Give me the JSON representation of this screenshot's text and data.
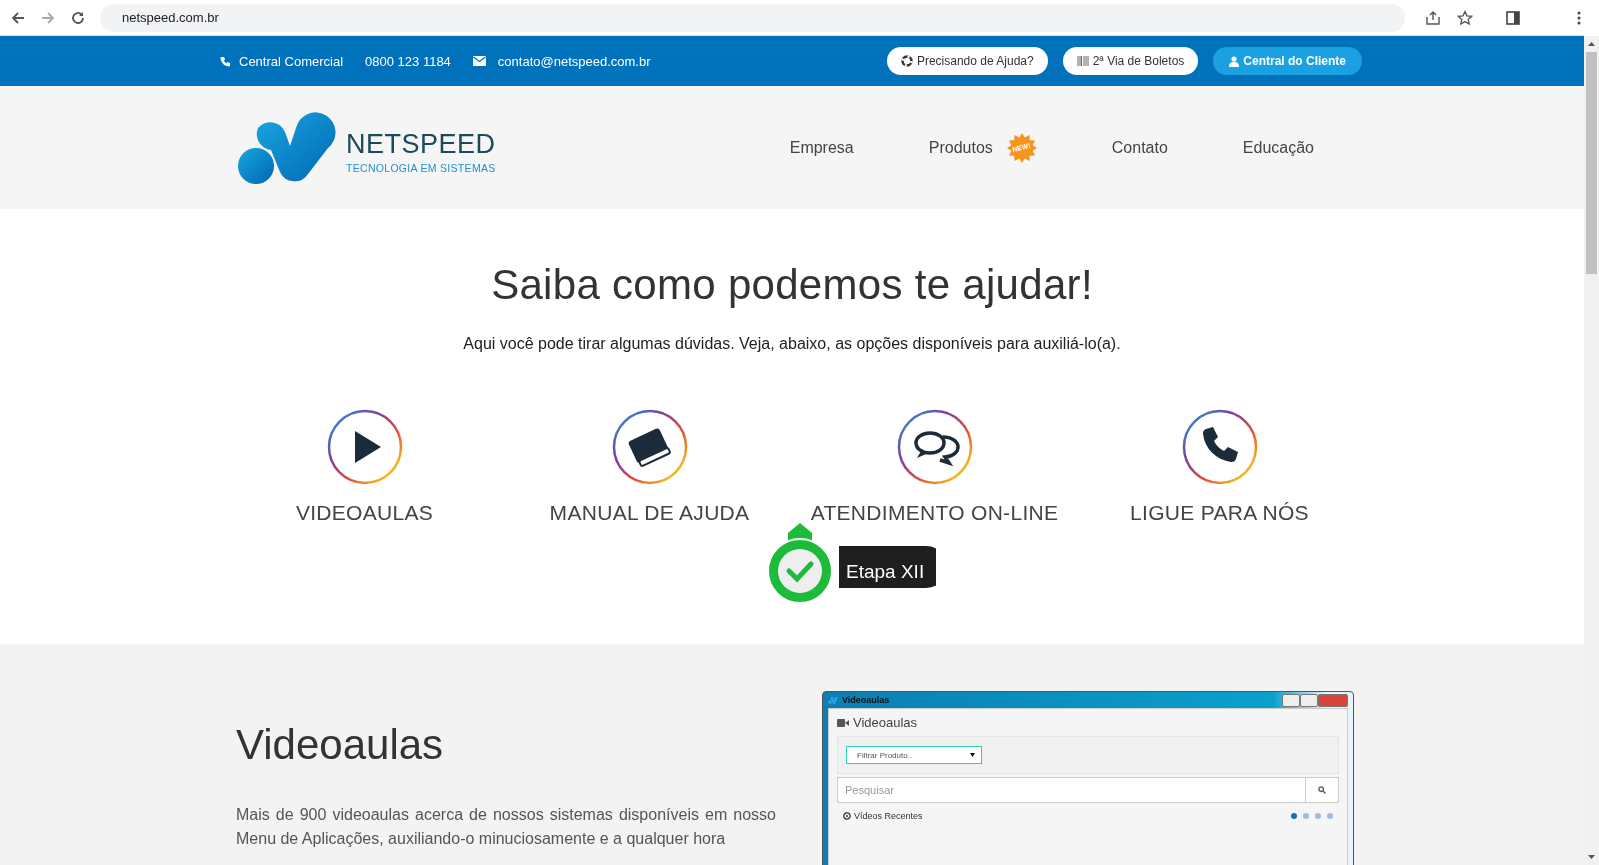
{
  "browser": {
    "url": "netspeed.com.br"
  },
  "topbar": {
    "phone_label": "Central Comercial",
    "phone": "0800 123 1184",
    "email": "contato@netspeed.com.br",
    "buttons": [
      {
        "label": "Precisando de Ajuda?",
        "kind": "help"
      },
      {
        "label": "2ª Via de Boletos",
        "kind": "barcode"
      },
      {
        "label": "Central do Cliente",
        "kind": "user"
      }
    ]
  },
  "logo": {
    "name": "NETSPEED",
    "tagline": "TECNOLOGIA EM SISTEMAS"
  },
  "nav": [
    {
      "label": "Empresa"
    },
    {
      "label": "Produtos",
      "badge": "NEW!"
    },
    {
      "label": "Contato"
    },
    {
      "label": "Educação"
    }
  ],
  "help": {
    "title": "Saiba como podemos te ajudar!",
    "subtitle": "Aqui você pode tirar algumas dúvidas. Veja, abaixo, as opções disponíveis para auxiliá-lo(a).",
    "options": [
      {
        "label": "VIDEOAULAS",
        "kind": "play"
      },
      {
        "label": "MANUAL DE AJUDA",
        "kind": "book"
      },
      {
        "label": "ATENDIMENTO ON-LINE",
        "kind": "chat",
        "step": "Etapa XII"
      },
      {
        "label": "LIGUE PARA NÓS",
        "kind": "phone"
      }
    ]
  },
  "videoaulas": {
    "title": "Videoaulas",
    "text": "Mais de 900 videoaulas acerca de nossos sistemas disponíveis em nosso Menu de Aplicações, auxiliando-o minuciosamente e a qualquer hora",
    "window": {
      "title": "Videoaulas",
      "heading": "Videoaulas",
      "filter": "Filtrar Produto..",
      "search_placeholder": "Pesquisar",
      "recent": "Vídeos Recentes",
      "pages": [
        {
          "selected": true
        },
        {
          "selected": false
        },
        {
          "selected": false
        },
        {
          "selected": false
        }
      ]
    }
  }
}
